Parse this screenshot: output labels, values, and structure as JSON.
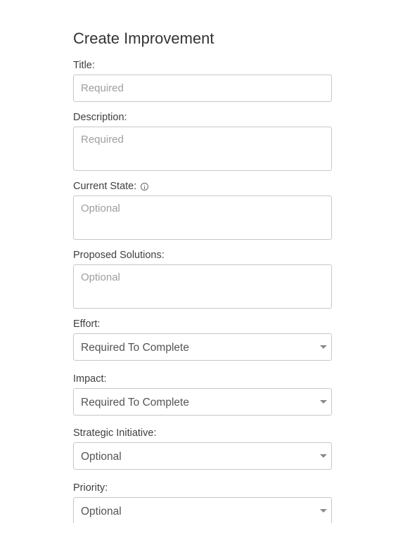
{
  "page": {
    "title": "Create Improvement"
  },
  "fields": {
    "title": {
      "label": "Title:",
      "placeholder": "Required",
      "value": ""
    },
    "description": {
      "label": "Description:",
      "placeholder": "Required",
      "value": ""
    },
    "current_state": {
      "label": "Current State:",
      "placeholder": "Optional",
      "value": "",
      "icon": "info-icon"
    },
    "proposed_solutions": {
      "label": "Proposed Solutions:",
      "placeholder": "Optional",
      "value": ""
    },
    "effort": {
      "label": "Effort:",
      "selected": "Required To Complete",
      "icon": "chevron-down-icon"
    },
    "impact": {
      "label": "Impact:",
      "selected": "Required To Complete",
      "icon": "chevron-down-icon"
    },
    "strategic_initiative": {
      "label": "Strategic Initiative:",
      "selected": "Optional",
      "icon": "chevron-down-icon"
    },
    "priority": {
      "label": "Priority:",
      "selected": "Optional",
      "icon": "chevron-down-icon"
    }
  }
}
